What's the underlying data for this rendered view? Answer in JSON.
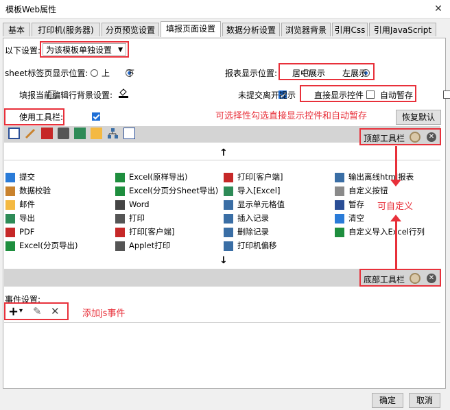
{
  "window": {
    "title": "模板Web属性",
    "close_label": "✕"
  },
  "tabs": [
    {
      "label": "基本"
    },
    {
      "label": "打印机(服务器)"
    },
    {
      "label": "分页预览设置"
    },
    {
      "label": "填报页面设置"
    },
    {
      "label": "数据分析设置"
    },
    {
      "label": "浏览器背景"
    },
    {
      "label": "引用Css"
    },
    {
      "label": "引用JavaScript"
    }
  ],
  "settings": {
    "below_label": "以下设置:",
    "below_value": "为该模板单独设置",
    "sheet_tab_label": "sheet标签页显示位置:",
    "sheet_opt_top": "上",
    "sheet_opt_bottom": "下",
    "report_pos_label": "报表显示位置:",
    "report_opt_center": "居中展示",
    "report_opt_left": "左展示",
    "fill_bg_label": "填报当前编辑行背景设置:",
    "unsubmitted_label": "未提交离开提示",
    "direct_show_label": "直接显示控件",
    "auto_save_label": "自动暂存",
    "use_toolbar_label": "使用工具栏:",
    "restore_default": "恢复默认"
  },
  "annotations": {
    "optional_note": "可选择性勾选直接显示控件和自动暂存",
    "customizable": "可自定义",
    "add_js": "添加js事件"
  },
  "toolbars": {
    "top_label": "顶部工具栏",
    "bottom_label": "底部工具栏",
    "up_arrow": "↑",
    "down_arrow": "↓"
  },
  "buttons_list": [
    [
      "提交",
      "Excel(原样导出)",
      "打印[客户端]",
      "输出离线html报表"
    ],
    [
      "数据校验",
      "Excel(分页分Sheet导出)",
      "导入[Excel]",
      "自定义按钮"
    ],
    [
      "邮件",
      "Word",
      "显示单元格值",
      "暂存"
    ],
    [
      "导出",
      "打印",
      "插入记录",
      "清空"
    ],
    [
      "PDF",
      "打印[客户端]",
      "删除记录",
      "自定义导入Excel行列"
    ],
    [
      "Excel(分页导出)",
      "Applet打印",
      "打印机偏移",
      ""
    ]
  ],
  "events": {
    "label": "事件设置:",
    "add_icon": "+",
    "dropdown_icon": "▾",
    "edit_icon": "✎",
    "delete_icon": "✕"
  },
  "footer": {
    "ok": "确定",
    "cancel": "取消"
  },
  "colors": {
    "accent_red": "#e8303a",
    "selected_blue": "#1f6fd6"
  }
}
